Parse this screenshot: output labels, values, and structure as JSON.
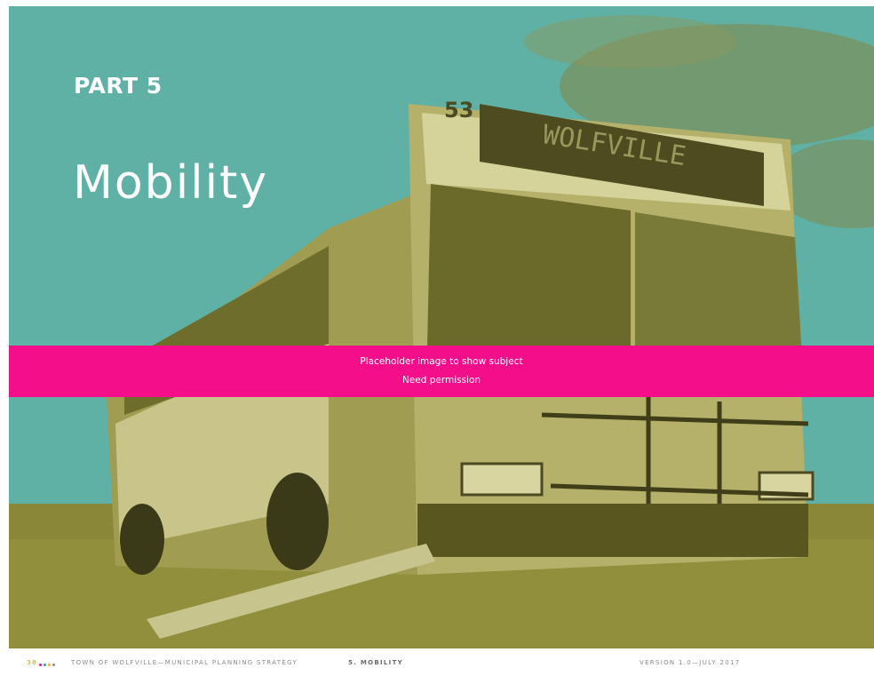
{
  "header": {
    "part_label": "PART 5",
    "chapter_title": "Mobility"
  },
  "photo": {
    "subject": "transit-bus",
    "route_number": "53",
    "destination_sign": "WOLFVILLE",
    "tint_colors": {
      "sky": "#5fb1a6",
      "body": "#8d8a33"
    }
  },
  "banner": {
    "line1": "Placeholder image to show subject",
    "line2": "Need permission",
    "color": "#f40e89"
  },
  "footer": {
    "page_number": "38",
    "dot_colors": [
      "#e21f8f",
      "#3a9b8f",
      "#d9c23a",
      "#8a8a8a"
    ],
    "document_title": "TOWN OF WOLFVILLE—MUNICIPAL PLANNING STRATEGY",
    "chapter_ref": "5. MOBILITY",
    "version": "VERSION 1.0—JULY 2017"
  }
}
